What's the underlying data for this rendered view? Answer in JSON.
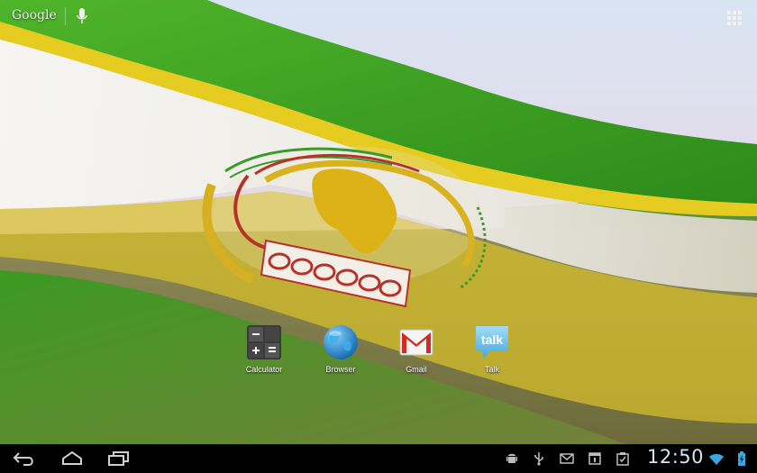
{
  "top_bar": {
    "search_label": "Google",
    "mic_icon": "mic-icon",
    "apps_icon": "all-apps-grid-icon"
  },
  "wallpaper": {
    "description_icon": "african-union-flag-live-wallpaper"
  },
  "dock": {
    "apps": [
      {
        "label": "Calculator",
        "icon": "calculator-icon"
      },
      {
        "label": "Browser",
        "icon": "browser-globe-icon"
      },
      {
        "label": "Gmail",
        "icon": "gmail-icon"
      },
      {
        "label": "Talk",
        "icon": "talk-icon",
        "icon_text": "talk"
      }
    ]
  },
  "nav_bar": {
    "buttons": [
      "back-icon",
      "home-icon",
      "recent-apps-icon"
    ],
    "status": {
      "clock": "12:50",
      "icons": [
        "android-debug-icon",
        "usb-icon",
        "gmail-notification-icon",
        "calendar-icon",
        "clipboard-icon",
        "wifi-icon",
        "battery-icon"
      ]
    }
  },
  "colors": {
    "flag_green": "#2f9a1c",
    "flag_yellow": "#e3c21e",
    "flag_white": "#f4f2ec",
    "emblem_gold": "#d9b31f",
    "emblem_red": "#b8312a",
    "clock_blue": "#cfe6f6",
    "nav_bg": "#000000"
  }
}
